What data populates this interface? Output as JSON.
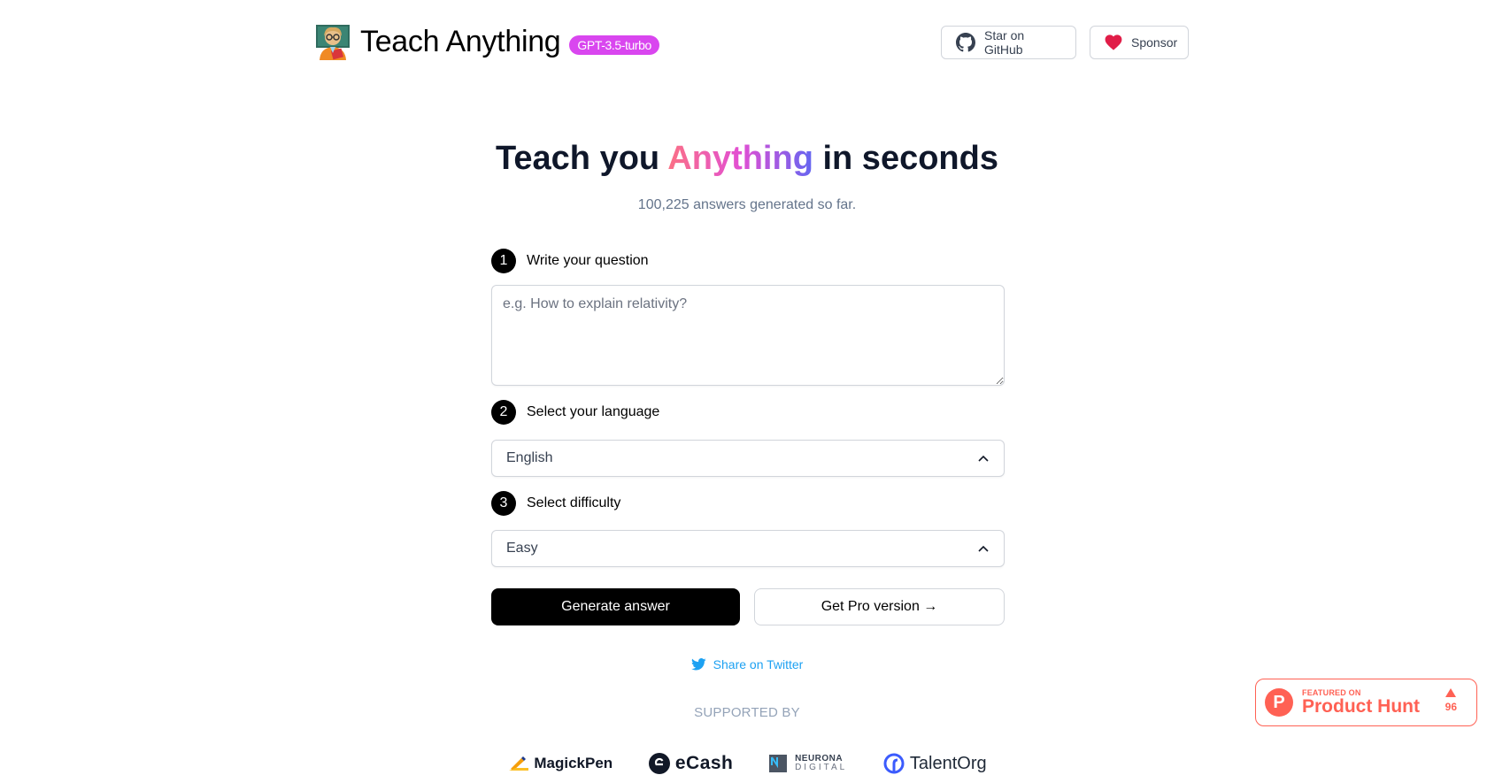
{
  "header": {
    "logo_icon": "teacher-emoji",
    "title": "Teach Anything",
    "model_badge": "GPT-3.5-turbo",
    "github_button": {
      "icon": "github-icon",
      "label": "Star on GitHub"
    },
    "sponsor_button": {
      "icon": "heart-icon",
      "label": "Sponsor"
    }
  },
  "hero": {
    "title_before": "Teach you ",
    "title_highlight": "Anything",
    "title_after": " in seconds",
    "subtitle": "100,225 answers generated so far."
  },
  "form": {
    "steps": [
      {
        "number": "1",
        "label": "Write your question"
      },
      {
        "number": "2",
        "label": "Select your language"
      },
      {
        "number": "3",
        "label": "Select difficulty"
      }
    ],
    "question": {
      "value": "",
      "placeholder": "e.g. How to explain relativity?"
    },
    "language": {
      "selected": "English"
    },
    "difficulty": {
      "selected": "Easy"
    },
    "generate_button": "Generate answer",
    "pro_button": "Get Pro version →"
  },
  "share": {
    "icon": "twitter-icon",
    "label": "Share on Twitter"
  },
  "supported": {
    "heading": "SUPPORTED BY",
    "sponsors": [
      {
        "name": "MagickPen",
        "icon": "pen-hand-icon"
      },
      {
        "name": "eCash",
        "icon": "ecash-logo-icon"
      },
      {
        "name": "NEURONA",
        "subtitle": "DIGITAL",
        "icon": "neurona-logo-icon"
      },
      {
        "name": "TalentOrg",
        "icon": "talentorg-logo-icon"
      }
    ]
  },
  "product_hunt": {
    "featured": "FEATURED ON",
    "name": "Product Hunt",
    "letter": "P",
    "votes": "96"
  },
  "colors": {
    "badge": "#d946ef",
    "twitter": "#1da1f2",
    "product_hunt": "#ff6154",
    "primary_button": "#000000"
  }
}
